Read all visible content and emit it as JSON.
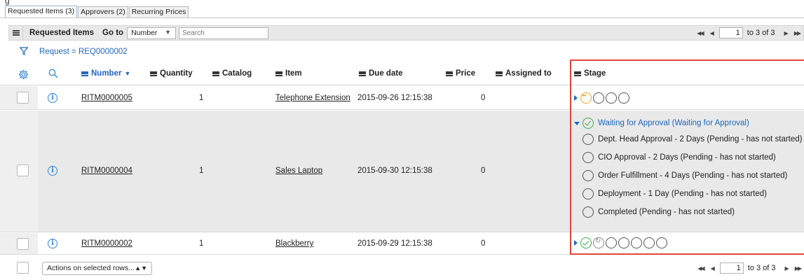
{
  "top_fragment": "g",
  "tabs": [
    {
      "label": "Requested Items (3)",
      "active": true
    },
    {
      "label": "Approvers (2)",
      "active": false
    },
    {
      "label": "Recurring Prices",
      "active": false
    }
  ],
  "toolbar": {
    "title": "Requested Items",
    "goto_label": "Go to",
    "goto_field": "Number",
    "search_placeholder": "Search",
    "page_value": "1",
    "page_text": "to 3 of 3"
  },
  "filter": {
    "text": "Request = REQ0000002"
  },
  "columns": {
    "number": "Number",
    "quantity": "Quantity",
    "catalog": "Catalog",
    "item": "Item",
    "due_date": "Due date",
    "price": "Price",
    "assigned_to": "Assigned to",
    "stage": "Stage"
  },
  "rows": [
    {
      "number": "RITM0000005",
      "quantity": "1",
      "item": "Telephone Extension",
      "due_date": "2015-09-26 12:15:38",
      "price": "0"
    },
    {
      "number": "RITM0000004",
      "quantity": "1",
      "item": "Sales Laptop",
      "due_date": "2015-09-30 12:15:38",
      "price": "0"
    },
    {
      "number": "RITM0000002",
      "quantity": "1",
      "item": "Blackberry",
      "due_date": "2015-09-29 12:15:38",
      "price": "0"
    }
  ],
  "stage_expanded": {
    "current": "Waiting for Approval (Waiting for Approval)",
    "steps": [
      "Dept. Head Approval - 2 Days (Pending - has not started)",
      "CIO Approval - 2 Days (Pending - has not started)",
      "Order Fulfillment - 4 Days (Pending - has not started)",
      "Deployment - 1 Day (Pending - has not started)",
      "Completed (Pending - has not started)"
    ]
  },
  "footer": {
    "actions_label": "Actions on selected rows...",
    "page_value": "1",
    "page_text": "to 3 of 3"
  },
  "colors": {
    "accent": "#1f67c0",
    "highlight": "#e0473a",
    "success": "#3eaa4c",
    "pending": "#e6a91f"
  }
}
